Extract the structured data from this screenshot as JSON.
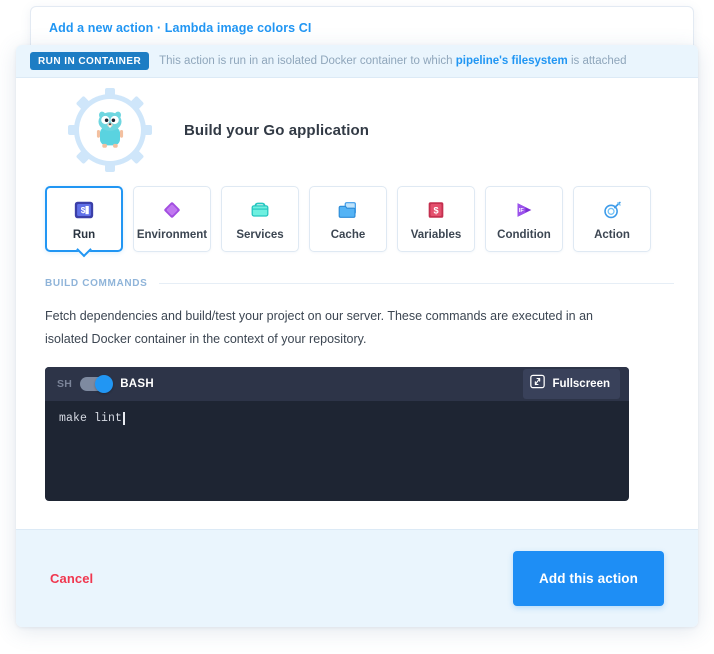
{
  "background_card": {
    "title": "Add a new action · Lambda image colors CI"
  },
  "banner": {
    "badge": "RUN IN CONTAINER",
    "text_before": "This action is run in an isolated Docker container to which ",
    "link": "pipeline's filesystem",
    "text_after": " is attached"
  },
  "header": {
    "logo_icon": "go-gopher-gear-icon",
    "title": "Build your Go application"
  },
  "tabs": [
    {
      "label": "Run",
      "icon": "terminal-prompt-icon",
      "active": true
    },
    {
      "label": "Environment",
      "icon": "diamond-icon",
      "active": false
    },
    {
      "label": "Services",
      "icon": "toolbox-icon",
      "active": false
    },
    {
      "label": "Cache",
      "icon": "folder-icon",
      "active": false
    },
    {
      "label": "Variables",
      "icon": "variables-book-icon",
      "active": false
    },
    {
      "label": "Condition",
      "icon": "if-play-icon",
      "active": false
    },
    {
      "label": "Action",
      "icon": "action-icon",
      "active": false
    }
  ],
  "build_commands": {
    "section_title": "BUILD COMMANDS",
    "description": "Fetch dependencies and build/test your project on our server. These commands are executed in an isolated Docker container in the context of your repository."
  },
  "terminal": {
    "shell_off_label": "SH",
    "shell_on_label": "BASH",
    "shell_selected": "BASH",
    "fullscreen_label": "Fullscreen",
    "fullscreen_icon": "fullscreen-expand-icon",
    "command": "make lint"
  },
  "footer": {
    "cancel_label": "Cancel",
    "submit_label": "Add this action"
  },
  "colors": {
    "accent_blue": "#2196f3",
    "submit_blue": "#1e8ef5",
    "badge_blue": "#1d7dc4",
    "banner_bg": "#eaf5fd",
    "cancel_red": "#f0374f",
    "terminal_bg": "#1e2533",
    "terminal_bar": "#2d3448"
  }
}
